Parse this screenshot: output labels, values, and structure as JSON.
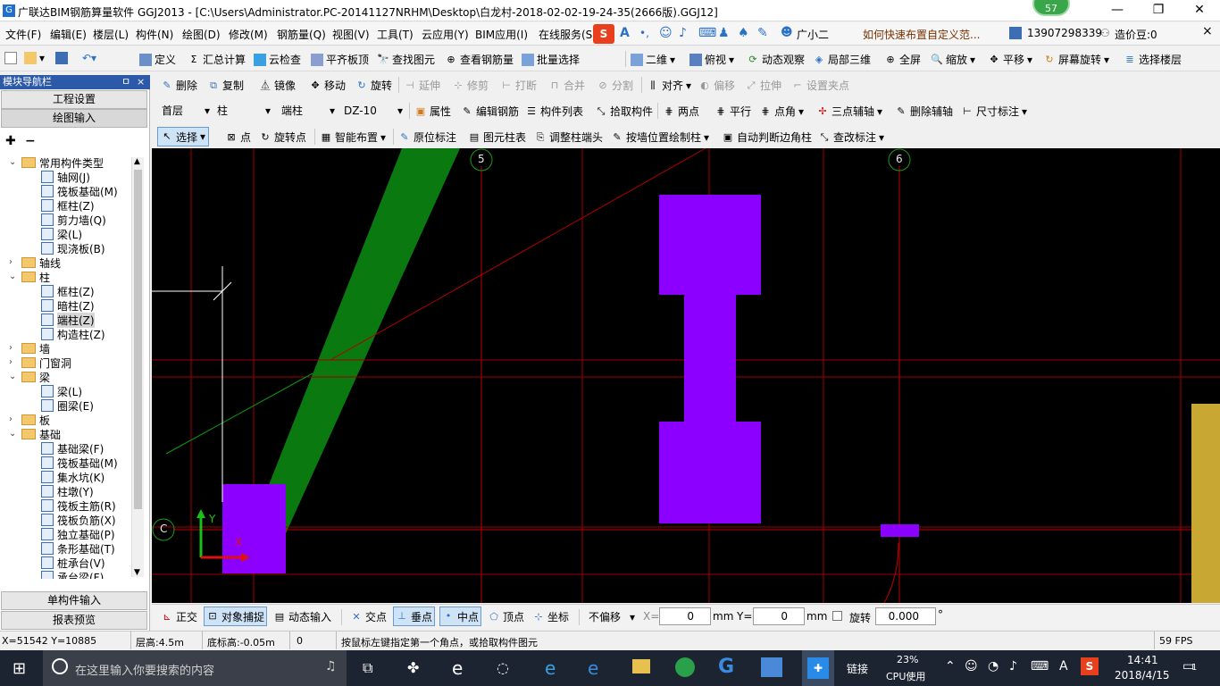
{
  "window": {
    "title": "广联达BIM钢筋算量软件 GGJ2013 - [C:\\Users\\Administrator.PC-20141127NRHM\\Desktop\\白龙村-2018-02-02-19-24-35(2666版).GGJ12]",
    "badge_count": "57",
    "btn_min": "—",
    "btn_max": "❐",
    "btn_close": "✕"
  },
  "menu": {
    "items": [
      "文件(F)",
      "编辑(E)",
      "楼层(L)",
      "构件(N)",
      "绘图(D)",
      "修改(M)",
      "钢筋量(Q)",
      "视图(V)",
      "工具(T)",
      "云应用(Y)",
      "BIM应用(I)",
      "在线服务(S"
    ],
    "ime_user": "广小二",
    "help_link": "如何快速布置自定义范...",
    "phone": "13907298339",
    "beans": "造价豆:0"
  },
  "toolbar1": {
    "items": [
      "定义",
      "汇总计算",
      "云检查",
      "平齐板顶",
      "查找图元",
      "查看钢筋量",
      "批量选择",
      "二维",
      "俯视",
      "动态观察",
      "局部三维",
      "全屏",
      "缩放",
      "平移",
      "屏幕旋转",
      "选择楼层"
    ]
  },
  "toolbar2": {
    "items": [
      "删除",
      "复制",
      "镜像",
      "移动",
      "旋转",
      "延伸",
      "修剪",
      "打断",
      "合并",
      "分割",
      "对齐",
      "偏移",
      "拉伸",
      "设置夹点"
    ]
  },
  "toolbar3": {
    "floor": "首层",
    "category": "柱",
    "type": "端柱",
    "component": "DZ-10",
    "items": [
      "属性",
      "编辑钢筋",
      "构件列表",
      "拾取构件",
      "两点",
      "平行",
      "点角",
      "三点辅轴",
      "删除辅轴",
      "尺寸标注"
    ]
  },
  "toolbar4": {
    "items": [
      "选择",
      "点",
      "旋转点",
      "智能布置",
      "原位标注",
      "图元柱表",
      "调整柱端头",
      "按墙位置绘制柱",
      "自动判断边角柱",
      "查改标注"
    ]
  },
  "nav": {
    "title": "模块导航栏",
    "pin": "ㅁ",
    "close": "×",
    "btn_project": "工程设置",
    "btn_draw": "绘图输入",
    "btn_single": "单构件输入",
    "btn_report": "报表预览",
    "tree": [
      {
        "label": "常用构件类型",
        "level": 0,
        "kind": "folder",
        "open": true
      },
      {
        "label": "轴网(J)",
        "level": 1,
        "kind": "item"
      },
      {
        "label": "筏板基础(M)",
        "level": 1,
        "kind": "item"
      },
      {
        "label": "框柱(Z)",
        "level": 1,
        "kind": "item"
      },
      {
        "label": "剪力墙(Q)",
        "level": 1,
        "kind": "item"
      },
      {
        "label": "梁(L)",
        "level": 1,
        "kind": "item"
      },
      {
        "label": "现浇板(B)",
        "level": 1,
        "kind": "item"
      },
      {
        "label": "轴线",
        "level": 0,
        "kind": "folder",
        "open": false
      },
      {
        "label": "柱",
        "level": 0,
        "kind": "folder",
        "open": true
      },
      {
        "label": "框柱(Z)",
        "level": 1,
        "kind": "item"
      },
      {
        "label": "暗柱(Z)",
        "level": 1,
        "kind": "item"
      },
      {
        "label": "端柱(Z)",
        "level": 1,
        "kind": "item",
        "selected": true
      },
      {
        "label": "构造柱(Z)",
        "level": 1,
        "kind": "item"
      },
      {
        "label": "墙",
        "level": 0,
        "kind": "folder",
        "open": false
      },
      {
        "label": "门窗洞",
        "level": 0,
        "kind": "folder",
        "open": false
      },
      {
        "label": "梁",
        "level": 0,
        "kind": "folder",
        "open": true
      },
      {
        "label": "梁(L)",
        "level": 1,
        "kind": "item"
      },
      {
        "label": "圈梁(E)",
        "level": 1,
        "kind": "item"
      },
      {
        "label": "板",
        "level": 0,
        "kind": "folder",
        "open": false
      },
      {
        "label": "基础",
        "level": 0,
        "kind": "folder",
        "open": true
      },
      {
        "label": "基础梁(F)",
        "level": 1,
        "kind": "item"
      },
      {
        "label": "筏板基础(M)",
        "level": 1,
        "kind": "item"
      },
      {
        "label": "集水坑(K)",
        "level": 1,
        "kind": "item"
      },
      {
        "label": "柱墩(Y)",
        "level": 1,
        "kind": "item"
      },
      {
        "label": "筏板主筋(R)",
        "level": 1,
        "kind": "item"
      },
      {
        "label": "筏板负筋(X)",
        "level": 1,
        "kind": "item"
      },
      {
        "label": "独立基础(P)",
        "level": 1,
        "kind": "item"
      },
      {
        "label": "条形基础(T)",
        "level": 1,
        "kind": "item"
      },
      {
        "label": "桩承台(V)",
        "level": 1,
        "kind": "item"
      },
      {
        "label": "承台梁(F)",
        "level": 1,
        "kind": "item"
      }
    ]
  },
  "canvas": {
    "axis_5": "5",
    "axis_6": "6",
    "axis_c": "C",
    "axis_y": "Y",
    "axis_x": "X",
    "colors": {
      "bg": "#000000",
      "column": "#8b00ff",
      "beam": "#0a7a10",
      "grid": "#c00000",
      "yellow": "#c8a832"
    }
  },
  "snapbar": {
    "items": [
      "正交",
      "对象捕捉",
      "动态输入",
      "交点",
      "垂点",
      "中点",
      "顶点",
      "坐标"
    ],
    "offset_mode": "不偏移",
    "x_label": "X=",
    "x_value": "0",
    "x_unit": "mm",
    "y_label": "Y=",
    "y_value": "0",
    "y_unit": "mm",
    "rotate_label": "旋转",
    "rotate_value": "0.000",
    "degree": "°"
  },
  "status": {
    "coords": "X=51542 Y=10885",
    "floor_height": "层高:4.5m",
    "base_height": "底标高:-0.05m",
    "zero": "0",
    "hint": "按鼠标左键指定第一个角点，或拾取构件图元",
    "fps": "59 FPS"
  },
  "taskbar": {
    "search_placeholder": "在这里输入你要搜索的内容",
    "link": "链接",
    "cpu_percent": "23%",
    "cpu_label": "CPU使用",
    "ime": "A",
    "time": "14:41",
    "date": "2018/4/15",
    "notif": "1"
  }
}
